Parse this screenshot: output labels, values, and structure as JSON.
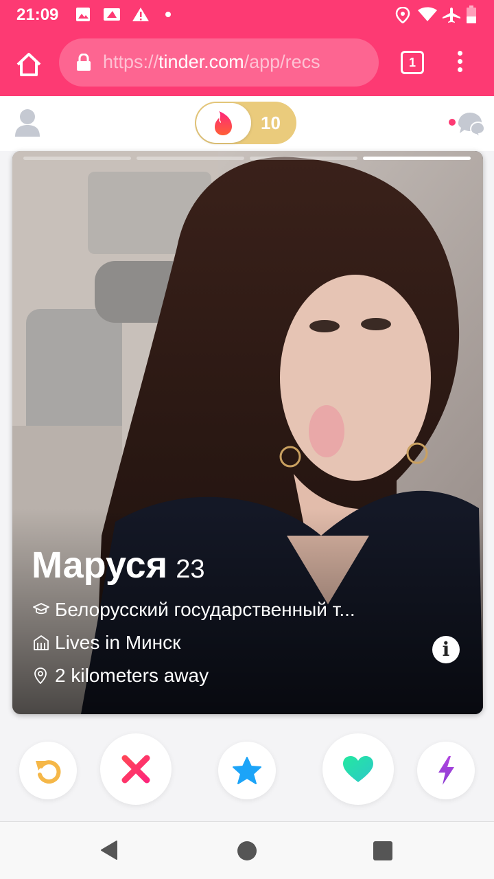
{
  "status_bar": {
    "time": "21:09",
    "icons_left": [
      "image-icon",
      "screenshot-icon",
      "warning-icon",
      "dot-icon"
    ],
    "icons_right": [
      "location-icon",
      "wifi-icon",
      "airplane-icon",
      "battery-icon"
    ]
  },
  "browser": {
    "url_prefix": "https://",
    "url_host": "tinder.com",
    "url_path": "/app/recs",
    "tab_count": "1",
    "accent": "#fd3a73"
  },
  "header": {
    "boost_count": "10"
  },
  "card": {
    "name": "Маруся",
    "age": "23",
    "school": "Белорусский государственный т...",
    "city": "Lives in Минск",
    "distance": "2 kilometers away",
    "photo_count": 4,
    "active_photo": 4
  },
  "actions": [
    "rewind",
    "nope",
    "super-like",
    "like",
    "boost"
  ],
  "colors": {
    "rewind": "#f5b748",
    "nope": "#fd5068",
    "super_like": "#1ca4f8",
    "like": "#1be4a1",
    "boost": "#a042d8",
    "boost_pill": "#eacb7c"
  }
}
